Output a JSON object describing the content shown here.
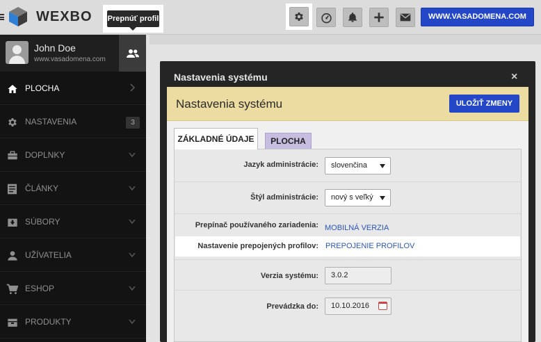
{
  "topbar": {
    "logo_text": "WEXBO",
    "tooltip": "Prepnúť profil",
    "domain_button": "WWW.VASADOMENA.COM",
    "icons": [
      "gear-icon",
      "speedometer-icon",
      "bell-icon",
      "plus-icon",
      "mail-icon"
    ]
  },
  "profile": {
    "name": "John Doe",
    "url": "www.vasadomena.com"
  },
  "sidebar": {
    "items": [
      {
        "label": "PLOCHA",
        "icon": "home-icon"
      },
      {
        "label": "NASTAVENIA",
        "icon": "gear-icon",
        "badge": "3"
      },
      {
        "label": "DOPLNKY",
        "icon": "briefcase-icon"
      },
      {
        "label": "ČLÁNKY",
        "icon": "article-icon"
      },
      {
        "label": "SÚBORY",
        "icon": "download-box-icon"
      },
      {
        "label": "UŽÍVATELIA",
        "icon": "user-icon"
      },
      {
        "label": "ESHOP",
        "icon": "cart-icon"
      },
      {
        "label": "PRODUKTY",
        "icon": "package-icon"
      }
    ]
  },
  "modal": {
    "title": "Nastavenia systému",
    "close": "×",
    "heading": "Nastavenia systému",
    "save_button": "ULOŽIŤ ZMENY",
    "tabs": [
      "ZÁKLADNÉ ÚDAJE",
      "PLOCHA"
    ],
    "fields": {
      "language_label": "Jazyk administrácie:",
      "language_value": "slovenčina",
      "style_label": "Štýl administrácie:",
      "style_value": "nový s veľký",
      "device_label": "Prepínač používaného zariadenia:",
      "device_link": "MOBILNÁ VERZIA",
      "profiles_label": "Nastavenie prepojených profilov:",
      "profiles_link": "PREPOJENIE PROFILOV",
      "version_label": "Verzia systému:",
      "version_value": "3.0.2",
      "since_label": "Prevádzka do:",
      "since_value": "10.10.2016"
    }
  },
  "colors": {
    "accent_blue": "#2347c6",
    "sidebar_bg": "#131313",
    "modal_header": "#ecdca1",
    "tab_secondary": "#c6bde0"
  }
}
